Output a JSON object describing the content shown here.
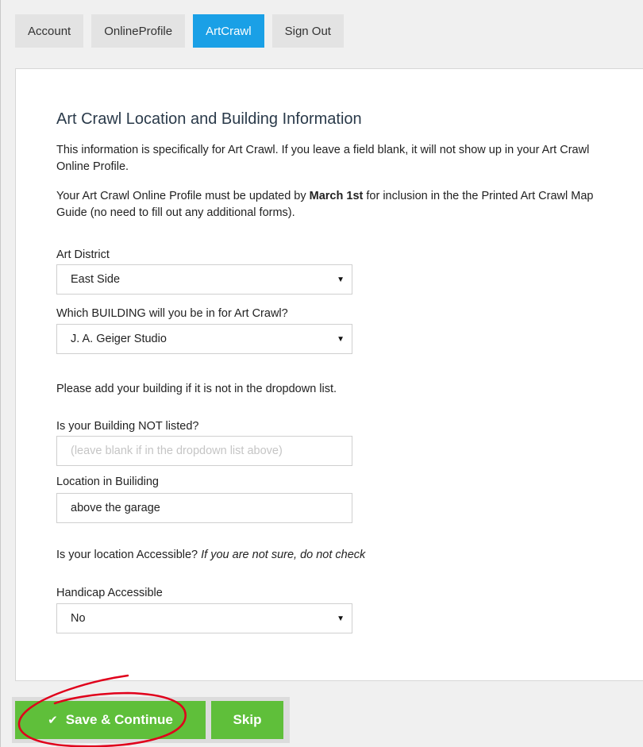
{
  "tabs": [
    {
      "label": "Account",
      "active": false
    },
    {
      "label": "OnlineProfile",
      "active": false
    },
    {
      "label": "ArtCrawl",
      "active": true
    },
    {
      "label": "Sign Out",
      "active": false
    }
  ],
  "section": {
    "title": "Art Crawl Location and Building Information",
    "intro": "This information is specifically for Art Crawl. If you leave a field blank, it will not show up in your Art Crawl Online Profile.",
    "deadline_prefix": "Your Art Crawl Online Profile must be updated by ",
    "deadline_date": "March 1st",
    "deadline_suffix": " for inclusion in the the Printed Art Crawl Map Guide (no need to fill out any additional forms).",
    "add_building_note": "Please add your building if it is not in the dropdown list.",
    "accessible_question": "Is your location Accessible? ",
    "accessible_hint": "If you are not sure, do not check"
  },
  "fields": {
    "district": {
      "label": "Art District",
      "value": "East Side"
    },
    "building": {
      "label": "Which BUILDING will you be in for Art Crawl?",
      "value": "J. A. Geiger Studio"
    },
    "unlisted": {
      "label": "Is your Building NOT listed?",
      "placeholder": "(leave blank if in the dropdown list above)",
      "value": ""
    },
    "location": {
      "label": "Location in Builiding",
      "value": "above the garage"
    },
    "handicap": {
      "label": "Handicap Accessible",
      "value": "No"
    }
  },
  "buttons": {
    "save": "Save & Continue",
    "skip": "Skip"
  },
  "colors": {
    "accent": "#1aa0e6",
    "button_green": "#5fbf3a",
    "annotation_red": "#e0001b"
  }
}
